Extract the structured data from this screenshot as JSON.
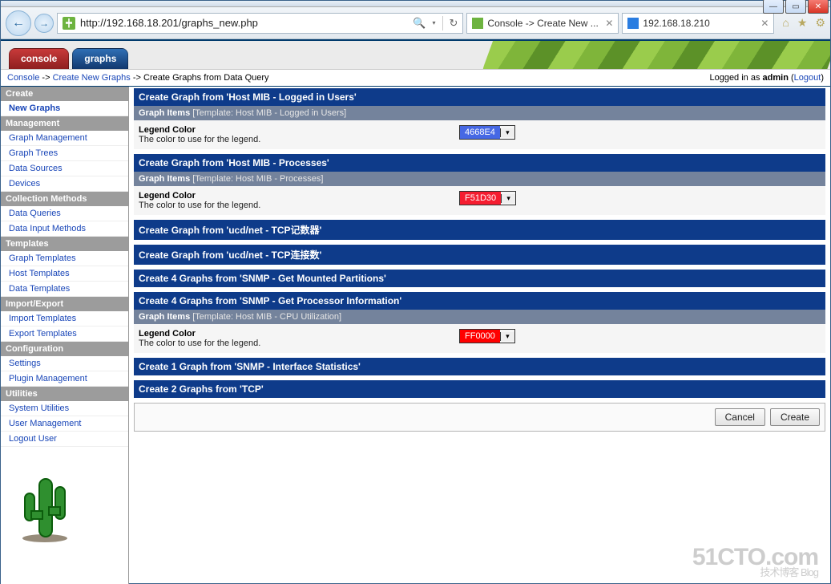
{
  "browser": {
    "url": "http://192.168.18.201/graphs_new.php",
    "tabs": [
      {
        "title": "Console -> Create New ...",
        "icon": "green"
      },
      {
        "title": "192.168.18.210",
        "icon": "blue"
      }
    ]
  },
  "header": {
    "tabs": {
      "console": "console",
      "graphs": "graphs"
    }
  },
  "breadcrumb": {
    "a": "Console",
    "b": "Create New Graphs",
    "c": "Create Graphs from Data Query",
    "status_prefix": "Logged in as ",
    "user": "admin",
    "logout": "Logout"
  },
  "sidebar": {
    "sections": [
      {
        "title": "Create",
        "items": [
          {
            "label": "New Graphs",
            "bold": true
          }
        ]
      },
      {
        "title": "Management",
        "items": [
          {
            "label": "Graph Management"
          },
          {
            "label": "Graph Trees"
          },
          {
            "label": "Data Sources"
          },
          {
            "label": "Devices"
          }
        ]
      },
      {
        "title": "Collection Methods",
        "items": [
          {
            "label": "Data Queries"
          },
          {
            "label": "Data Input Methods"
          }
        ]
      },
      {
        "title": "Templates",
        "items": [
          {
            "label": "Graph Templates"
          },
          {
            "label": "Host Templates"
          },
          {
            "label": "Data Templates"
          }
        ]
      },
      {
        "title": "Import/Export",
        "items": [
          {
            "label": "Import Templates"
          },
          {
            "label": "Export Templates"
          }
        ]
      },
      {
        "title": "Configuration",
        "items": [
          {
            "label": "Settings"
          },
          {
            "label": "Plugin Management"
          }
        ]
      },
      {
        "title": "Utilities",
        "items": [
          {
            "label": "System Utilities"
          },
          {
            "label": "User Management"
          },
          {
            "label": "Logout User"
          }
        ]
      }
    ]
  },
  "content": {
    "legend_label": "Legend Color",
    "legend_desc": "The color to use for the legend.",
    "graph_items_label": "Graph Items",
    "groups": [
      {
        "title": "Create Graph from 'Host MIB - Logged in Users'",
        "sub": "[Template: Host MIB - Logged in Users]",
        "color": {
          "code": "4668E4",
          "bg": "#4668E4",
          "fg": "#fff"
        }
      },
      {
        "title": "Create Graph from 'Host MIB - Processes'",
        "sub": "[Template: Host MIB - Processes]",
        "color": {
          "code": "F51D30",
          "bg": "#F51D30",
          "fg": "#fff"
        }
      },
      {
        "title": "Create Graph from 'ucd/net - TCP记数器'"
      },
      {
        "title": "Create Graph from 'ucd/net - TCP连接数'"
      },
      {
        "title": "Create 4 Graphs from 'SNMP - Get Mounted Partitions'"
      },
      {
        "title": "Create 4 Graphs from 'SNMP - Get Processor Information'",
        "sub": "[Template: Host MIB - CPU Utilization]",
        "color": {
          "code": "FF0000",
          "bg": "#FF0000",
          "fg": "#fff"
        }
      },
      {
        "title": "Create 1 Graph from 'SNMP - Interface Statistics'"
      },
      {
        "title": "Create 2 Graphs from 'TCP'"
      }
    ],
    "buttons": {
      "cancel": "Cancel",
      "create": "Create"
    }
  },
  "watermark": {
    "line1": "51CTO.com",
    "line2": "技术博客  Blog"
  }
}
